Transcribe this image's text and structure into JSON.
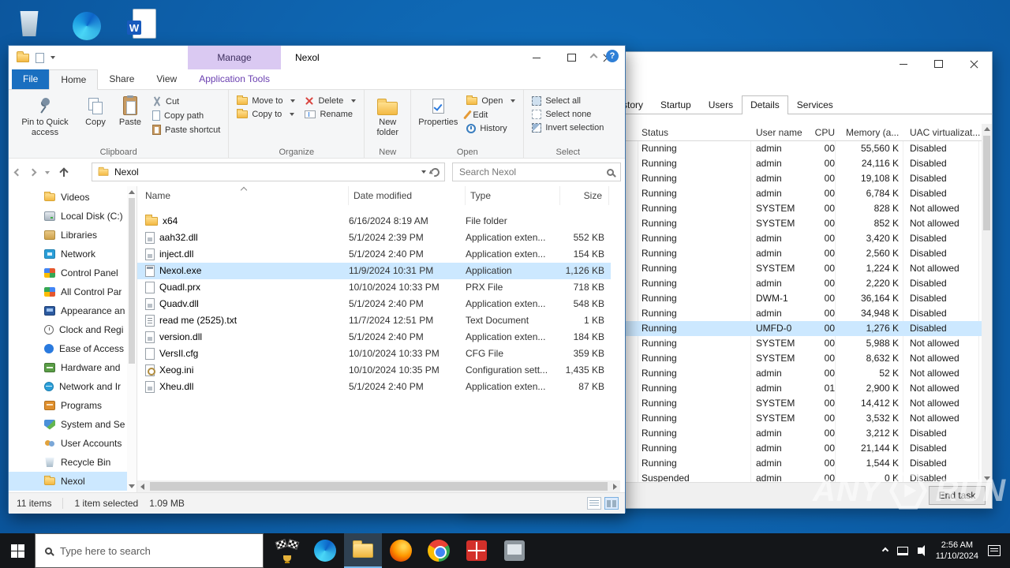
{
  "desktop": {
    "word_letter": "W"
  },
  "explorer": {
    "title": "Nexol",
    "help_glyph": "?",
    "contextual_group": "Manage",
    "tabs": [
      {
        "label": "File",
        "cls": "file"
      },
      {
        "label": "Home",
        "cls": "active"
      },
      {
        "label": "Share",
        "cls": ""
      },
      {
        "label": "View",
        "cls": ""
      },
      {
        "label": "Application Tools",
        "cls": "contextual"
      }
    ],
    "ribbon": {
      "pin_label": "Pin to Quick access",
      "copy_label": "Copy",
      "paste_label": "Paste",
      "cut_label": "Cut",
      "copy_path_label": "Copy path",
      "paste_shortcut_label": "Paste shortcut",
      "clipboard_group": "Clipboard",
      "move_to_label": "Move to",
      "copy_to_label": "Copy to",
      "delete_label": "Delete",
      "rename_label": "Rename",
      "organize_group": "Organize",
      "new_folder_label": "New folder",
      "new_group": "New",
      "properties_label": "Properties",
      "open_label": "Open",
      "edit_label": "Edit",
      "history_label": "History",
      "open_group": "Open",
      "select_all_label": "Select all",
      "select_none_label": "Select none",
      "invert_label": "Invert selection",
      "select_group": "Select"
    },
    "address": {
      "path": "Nexol",
      "search_placeholder": "Search Nexol"
    },
    "sidebar": [
      {
        "label": "Videos",
        "icon": "folder"
      },
      {
        "label": "Local Disk (C:)",
        "icon": "drive"
      },
      {
        "label": "Libraries",
        "icon": "libraries"
      },
      {
        "label": "Network",
        "icon": "network"
      },
      {
        "label": "Control Panel",
        "icon": "controlpanel"
      },
      {
        "label": "All Control Par",
        "icon": "grid"
      },
      {
        "label": "Appearance an",
        "icon": "display"
      },
      {
        "label": "Clock and Regi",
        "icon": "clock"
      },
      {
        "label": "Ease of Access",
        "icon": "access"
      },
      {
        "label": "Hardware and",
        "icon": "hardware"
      },
      {
        "label": "Network and Ir",
        "icon": "globe"
      },
      {
        "label": "Programs",
        "icon": "programs"
      },
      {
        "label": "System and Se",
        "icon": "shield"
      },
      {
        "label": "User Accounts",
        "icon": "users"
      },
      {
        "label": "Recycle Bin",
        "icon": "bin"
      },
      {
        "label": "Nexol",
        "icon": "folder",
        "selected": true
      }
    ],
    "columns": {
      "name": "Name",
      "modified": "Date modified",
      "type": "Type",
      "size": "Size"
    },
    "files": [
      {
        "name": "x64",
        "modified": "6/16/2024 8:19 AM",
        "type": "File folder",
        "size": "",
        "icon": "folder"
      },
      {
        "name": "aah32.dll",
        "modified": "5/1/2024 2:39 PM",
        "type": "Application exten...",
        "size": "552 KB",
        "icon": "dll"
      },
      {
        "name": "inject.dll",
        "modified": "5/1/2024 2:40 PM",
        "type": "Application exten...",
        "size": "154 KB",
        "icon": "dll"
      },
      {
        "name": "Nexol.exe",
        "modified": "11/9/2024 10:31 PM",
        "type": "Application",
        "size": "1,126 KB",
        "icon": "exe",
        "selected": true
      },
      {
        "name": "Quadl.prx",
        "modified": "10/10/2024 10:33 PM",
        "type": "PRX File",
        "size": "718 KB",
        "icon": "file"
      },
      {
        "name": "Quadv.dll",
        "modified": "5/1/2024 2:40 PM",
        "type": "Application exten...",
        "size": "548 KB",
        "icon": "dll"
      },
      {
        "name": "read me (2525).txt",
        "modified": "11/7/2024 12:51 PM",
        "type": "Text Document",
        "size": "1 KB",
        "icon": "txt"
      },
      {
        "name": "version.dll",
        "modified": "5/1/2024 2:40 PM",
        "type": "Application exten...",
        "size": "184 KB",
        "icon": "dll"
      },
      {
        "name": "VersIl.cfg",
        "modified": "10/10/2024 10:33 PM",
        "type": "CFG File",
        "size": "359 KB",
        "icon": "file"
      },
      {
        "name": "Xeog.ini",
        "modified": "10/10/2024 10:35 PM",
        "type": "Configuration sett...",
        "size": "1,435 KB",
        "icon": "ini"
      },
      {
        "name": "Xheu.dll",
        "modified": "5/1/2024 2:40 PM",
        "type": "Application exten...",
        "size": "87 KB",
        "icon": "dll"
      }
    ],
    "status": {
      "items": "11 items",
      "selection": "1 item selected",
      "size": "1.09 MB"
    }
  },
  "taskmgr": {
    "tabs": [
      {
        "label": "App history"
      },
      {
        "label": "Startup"
      },
      {
        "label": "Users"
      },
      {
        "label": "Details",
        "active": true
      },
      {
        "label": "Services"
      }
    ],
    "columns": [
      "Status",
      "User name",
      "CPU",
      "Memory (a...",
      "UAC virtualizat..."
    ],
    "rows": [
      {
        "status": "Running",
        "user": "admin",
        "cpu": "00",
        "mem": "55,560 K",
        "uac": "Disabled"
      },
      {
        "status": "Running",
        "user": "admin",
        "cpu": "00",
        "mem": "24,116 K",
        "uac": "Disabled"
      },
      {
        "status": "Running",
        "user": "admin",
        "cpu": "00",
        "mem": "19,108 K",
        "uac": "Disabled"
      },
      {
        "status": "Running",
        "user": "admin",
        "cpu": "00",
        "mem": "6,784 K",
        "uac": "Disabled"
      },
      {
        "status": "Running",
        "user": "SYSTEM",
        "cpu": "00",
        "mem": "828 K",
        "uac": "Not allowed"
      },
      {
        "status": "Running",
        "user": "SYSTEM",
        "cpu": "00",
        "mem": "852 K",
        "uac": "Not allowed"
      },
      {
        "status": "Running",
        "user": "admin",
        "cpu": "00",
        "mem": "3,420 K",
        "uac": "Disabled"
      },
      {
        "status": "Running",
        "user": "admin",
        "cpu": "00",
        "mem": "2,560 K",
        "uac": "Disabled"
      },
      {
        "status": "Running",
        "user": "SYSTEM",
        "cpu": "00",
        "mem": "1,224 K",
        "uac": "Not allowed"
      },
      {
        "status": "Running",
        "user": "admin",
        "cpu": "00",
        "mem": "2,220 K",
        "uac": "Disabled"
      },
      {
        "status": "Running",
        "user": "DWM-1",
        "cpu": "00",
        "mem": "36,164 K",
        "uac": "Disabled"
      },
      {
        "status": "Running",
        "user": "admin",
        "cpu": "00",
        "mem": "34,948 K",
        "uac": "Disabled"
      },
      {
        "status": "Running",
        "user": "UMFD-0",
        "cpu": "00",
        "mem": "1,276 K",
        "uac": "Disabled",
        "selected": true
      },
      {
        "status": "Running",
        "user": "SYSTEM",
        "cpu": "00",
        "mem": "5,988 K",
        "uac": "Not allowed"
      },
      {
        "status": "Running",
        "user": "SYSTEM",
        "cpu": "00",
        "mem": "8,632 K",
        "uac": "Not allowed"
      },
      {
        "status": "Running",
        "user": "admin",
        "cpu": "00",
        "mem": "52 K",
        "uac": "Not allowed"
      },
      {
        "status": "Running",
        "user": "admin",
        "cpu": "01",
        "mem": "2,900 K",
        "uac": "Not allowed"
      },
      {
        "status": "Running",
        "user": "SYSTEM",
        "cpu": "00",
        "mem": "14,412 K",
        "uac": "Not allowed"
      },
      {
        "status": "Running",
        "user": "SYSTEM",
        "cpu": "00",
        "mem": "3,532 K",
        "uac": "Not allowed"
      },
      {
        "status": "Running",
        "user": "admin",
        "cpu": "00",
        "mem": "3,212 K",
        "uac": "Disabled"
      },
      {
        "status": "Running",
        "user": "admin",
        "cpu": "00",
        "mem": "21,144 K",
        "uac": "Disabled"
      },
      {
        "status": "Running",
        "user": "admin",
        "cpu": "00",
        "mem": "1,544 K",
        "uac": "Disabled"
      },
      {
        "status": "Suspended",
        "user": "admin",
        "cpu": "00",
        "mem": "0 K",
        "uac": "Disabled"
      }
    ],
    "end_task_label": "End task"
  },
  "watermark": {
    "left": "ANY",
    "right": "RUN"
  },
  "taskbar": {
    "search_placeholder": "Type here to search",
    "time": "2:56 AM",
    "date": "11/10/2024"
  }
}
